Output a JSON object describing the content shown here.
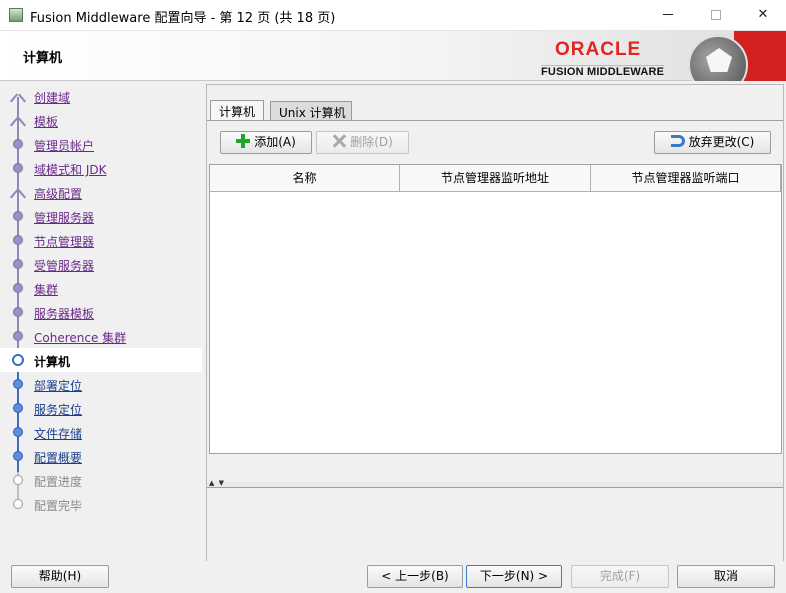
{
  "window": {
    "title": "Fusion Middleware 配置向导 - 第 12 页 (共 18 页)",
    "minimize": "—",
    "maximize": "",
    "close": "✕"
  },
  "header": {
    "page_title": "计算机",
    "brand": "ORACLE",
    "brand_sub": "FUSION MIDDLEWARE",
    "brand_color": "#e4241e"
  },
  "nav": {
    "items": [
      {
        "label": "创建域",
        "state": "done"
      },
      {
        "label": "模板",
        "state": "done"
      },
      {
        "label": "管理员帐户",
        "state": "done"
      },
      {
        "label": "域模式和 JDK",
        "state": "done"
      },
      {
        "label": "高级配置",
        "state": "done"
      },
      {
        "label": "管理服务器",
        "state": "done"
      },
      {
        "label": "节点管理器",
        "state": "done"
      },
      {
        "label": "受管服务器",
        "state": "done"
      },
      {
        "label": "集群",
        "state": "done"
      },
      {
        "label": "服务器模板",
        "state": "done"
      },
      {
        "label": "Coherence 集群",
        "state": "done"
      },
      {
        "label": "计算机",
        "state": "current"
      },
      {
        "label": "部署定位",
        "state": "todo"
      },
      {
        "label": "服务定位",
        "state": "todo"
      },
      {
        "label": "文件存储",
        "state": "todo"
      },
      {
        "label": "配置概要",
        "state": "todo"
      },
      {
        "label": "配置进度",
        "state": "future"
      },
      {
        "label": "配置完毕",
        "state": "future"
      }
    ]
  },
  "tabs": [
    {
      "label": "计算机"
    },
    {
      "label": "Unix 计算机"
    }
  ],
  "toolbar": {
    "add_label": "添加(A)",
    "delete_label": "删除(D)",
    "revert_label": "放弃更改(C)"
  },
  "table": {
    "columns": [
      "名称",
      "节点管理器监听地址",
      "节点管理器监听端口"
    ],
    "rows": []
  },
  "footer": {
    "help_label": "帮助(H)",
    "back_label": "< 上一步(B)",
    "next_label": "下一步(N) >",
    "finish_label": "完成(F)",
    "cancel_label": "取消"
  }
}
